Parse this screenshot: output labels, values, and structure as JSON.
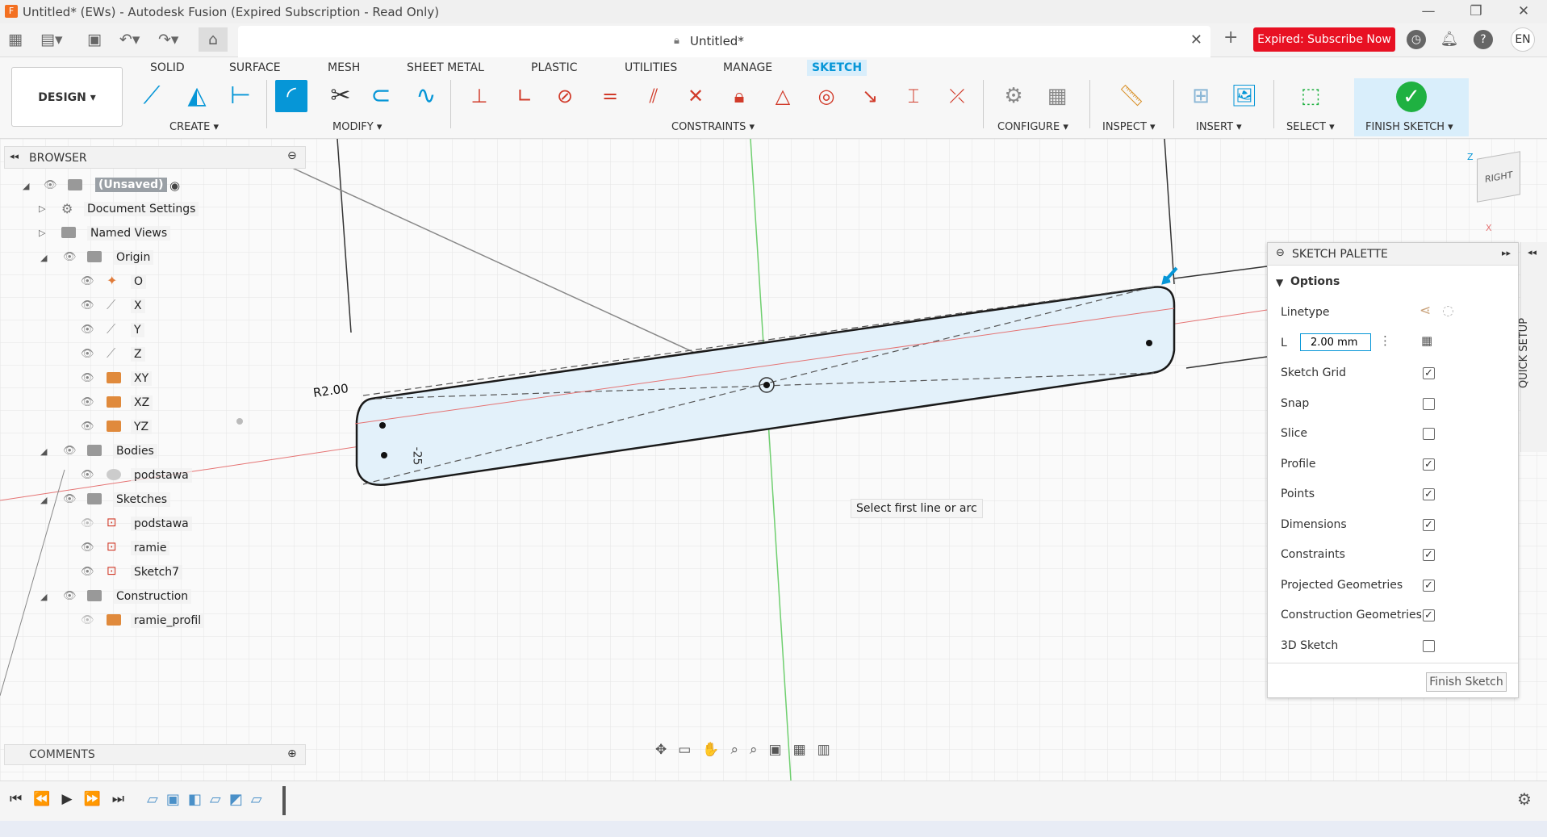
{
  "titlebar": {
    "title": "Untitled* (EWs) - Autodesk Fusion (Expired Subscription - Read Only)",
    "minimize": "—",
    "restore": "❐",
    "close": "✕"
  },
  "doc_tab": {
    "name": "Untitled*",
    "close": "✕"
  },
  "tabbar": {
    "expired_label": "Expired: Subscribe Now",
    "lang": "EN",
    "help": "?"
  },
  "ribbon": {
    "design_label": "DESIGN ▾",
    "tabs": [
      "SOLID",
      "SURFACE",
      "MESH",
      "SHEET METAL",
      "PLASTIC",
      "UTILITIES",
      "MANAGE",
      "SKETCH"
    ],
    "groups": {
      "create": "CREATE ▾",
      "modify": "MODIFY ▾",
      "constraints": "CONSTRAINTS ▾",
      "configure": "CONFIGURE ▾",
      "inspect": "INSPECT ▾",
      "insert": "INSERT ▾",
      "select": "SELECT ▾",
      "finish": "FINISH SKETCH ▾"
    }
  },
  "browser": {
    "title": "BROWSER",
    "items": [
      {
        "label": "(Unsaved)"
      },
      {
        "label": "Document Settings"
      },
      {
        "label": "Named Views"
      },
      {
        "label": "Origin"
      },
      {
        "label": "O"
      },
      {
        "label": "X"
      },
      {
        "label": "Y"
      },
      {
        "label": "Z"
      },
      {
        "label": "XY"
      },
      {
        "label": "XZ"
      },
      {
        "label": "YZ"
      },
      {
        "label": "Bodies"
      },
      {
        "label": "podstawa"
      },
      {
        "label": "Sketches"
      },
      {
        "label": "podstawa"
      },
      {
        "label": "ramie"
      },
      {
        "label": "Sketch7"
      },
      {
        "label": "Construction"
      },
      {
        "label": "ramie_profil"
      }
    ]
  },
  "canvas": {
    "dim_radius": "R2.00",
    "dim_neg": "-25",
    "tooltip": "Select first line or arc",
    "viewcube_face": "RIGHT",
    "axis_z": "Z",
    "axis_x": "X"
  },
  "palette": {
    "title": "SKETCH PALETTE",
    "section": "Options",
    "linetype": "Linetype",
    "length_label": "L",
    "length_value": "2.00 mm",
    "options": [
      {
        "label": "Sketch Grid",
        "checked": "✓"
      },
      {
        "label": "Snap",
        "checked": ""
      },
      {
        "label": "Slice",
        "checked": ""
      },
      {
        "label": "Profile",
        "checked": "✓"
      },
      {
        "label": "Points",
        "checked": "✓"
      },
      {
        "label": "Dimensions",
        "checked": "✓"
      },
      {
        "label": "Constraints",
        "checked": "✓"
      },
      {
        "label": "Projected Geometries",
        "checked": "✓"
      },
      {
        "label": "Construction Geometries",
        "checked": "✓"
      },
      {
        "label": "3D Sketch",
        "checked": ""
      }
    ],
    "finish_button": "Finish Sketch"
  },
  "quick_setup": "QUICK SETUP",
  "comments": {
    "title": "COMMENTS"
  },
  "colors": {
    "accent": "#0696d7",
    "expired": "#e81123",
    "finish": "#1fb141",
    "sketch_fill": "#e3f1fa"
  }
}
